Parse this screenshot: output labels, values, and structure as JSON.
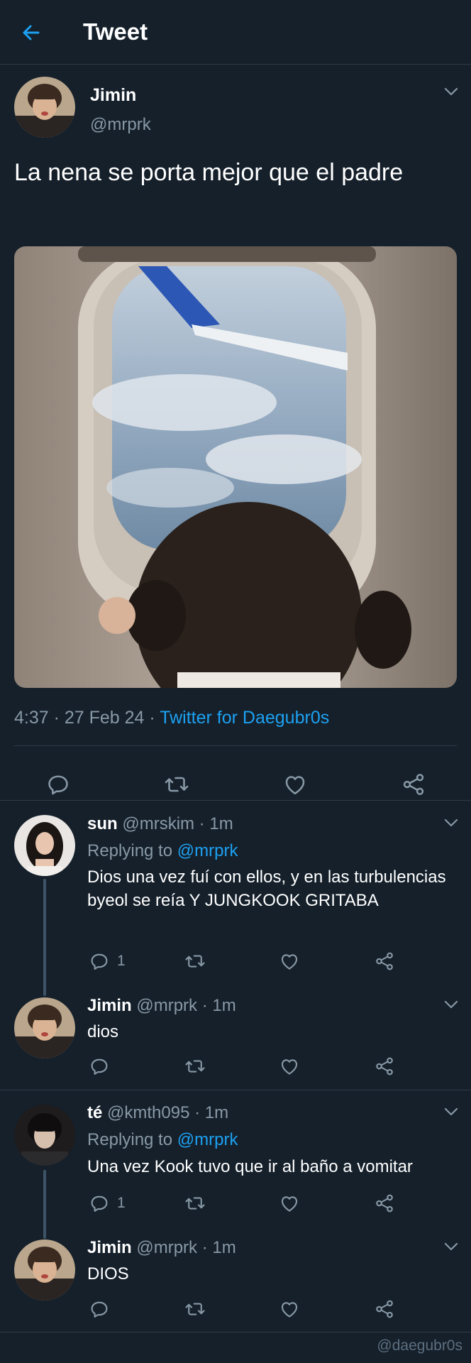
{
  "header": {
    "title": "Tweet",
    "back_icon": "arrow-left-icon"
  },
  "main_tweet": {
    "name": "Jimin",
    "handle": "@mrprk",
    "text": "La nena se porta mejor que el padre",
    "time": "4:37 · 27 Feb 24 · ",
    "source": "Twitter for Daegubr0s",
    "actions": [
      "reply-icon",
      "retweet-icon",
      "like-icon",
      "share-icon"
    ]
  },
  "replies": [
    {
      "name": "sun",
      "handle_time": " @mrskim · 1m",
      "replying_label": "Replying to ",
      "replying_to": "@mrprk",
      "text": "Dios una vez fuí con ellos, y en las turbulencias byeol se reía Y JUNGKOOK GRITABA",
      "reply_count": "1"
    },
    {
      "name": "Jimin",
      "handle_time": " @mrprk · 1m",
      "text": "dios"
    },
    {
      "name": "té",
      "handle_time": " @kmth095 · 1m",
      "replying_label": "Replying to ",
      "replying_to": "@mrprk",
      "text": "Una vez Kook tuvo que ir al baño a vomitar",
      "reply_count": "1"
    },
    {
      "name": "Jimin",
      "handle_time": " @mrprk · 1m",
      "text": "DIOS"
    }
  ],
  "watermark": "@daegubr0s",
  "colors": {
    "background": "#15202b",
    "accent": "#1da1f2",
    "muted": "#8899a6",
    "divider": "#2f3b48"
  }
}
